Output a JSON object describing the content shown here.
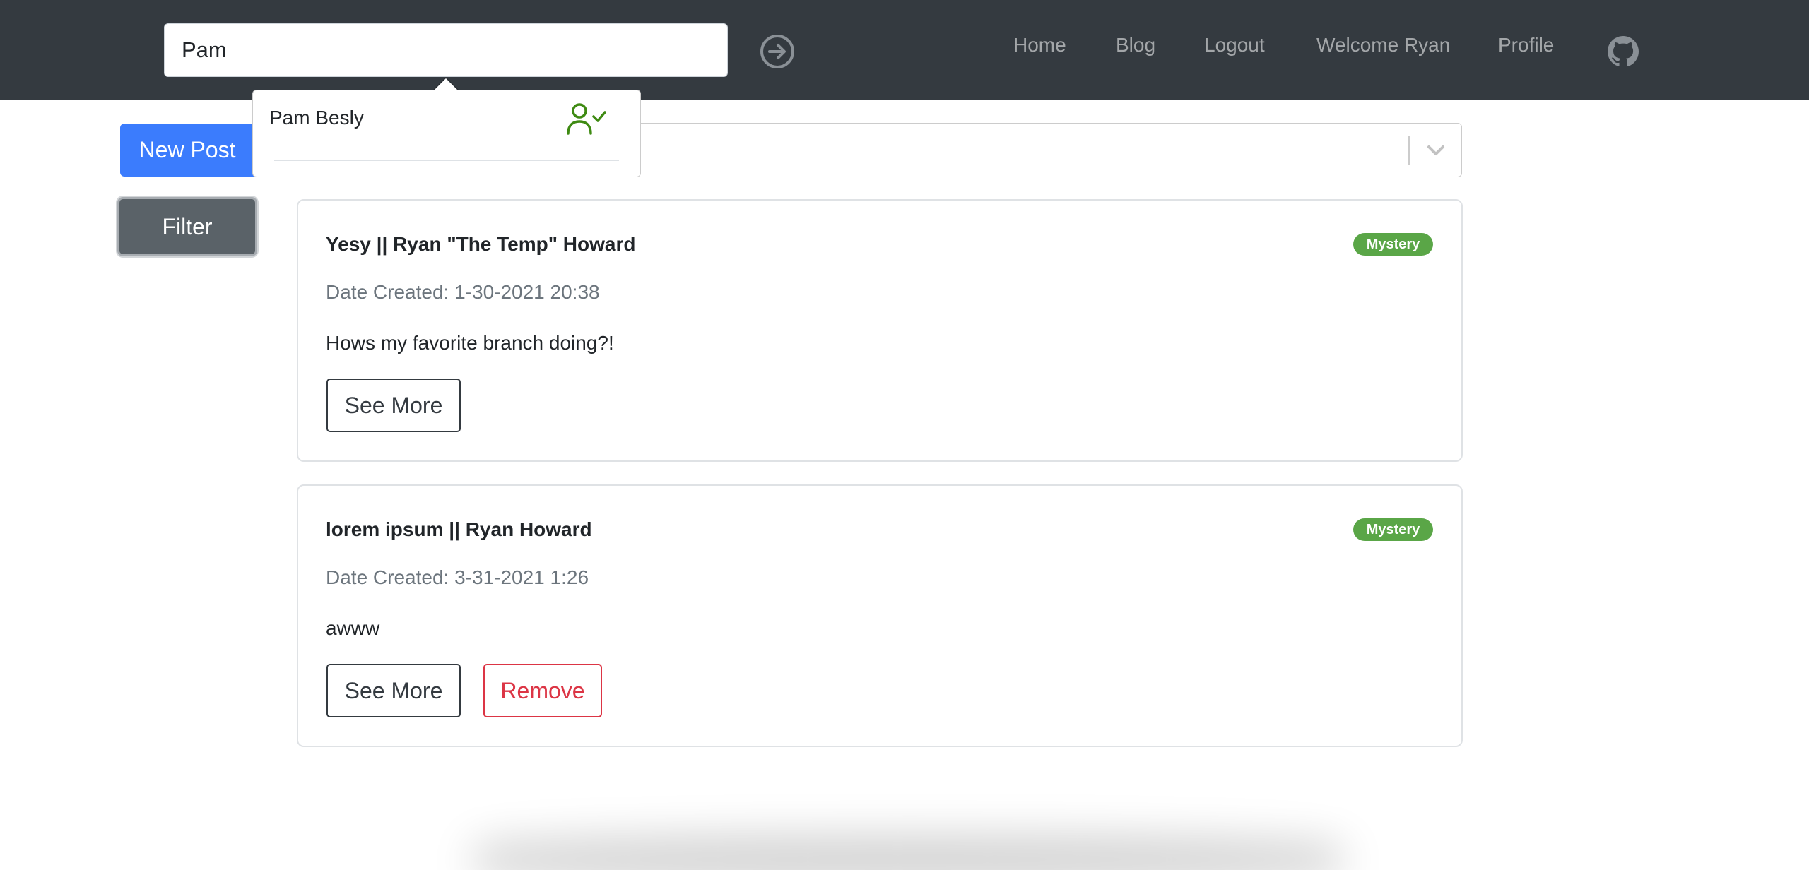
{
  "search": {
    "value": "Pam",
    "submit_icon": "arrow-right-circle-icon"
  },
  "nav": {
    "links": [
      {
        "label": "Home"
      },
      {
        "label": "Blog"
      },
      {
        "label": "Logout"
      },
      {
        "label": "Welcome Ryan"
      },
      {
        "label": "Profile"
      }
    ],
    "github_icon": "github-icon"
  },
  "actions": {
    "new_post_label": "New Post",
    "filter_label": "Filter"
  },
  "category_select": {
    "value": "",
    "chevron_icon": "chevron-down-icon"
  },
  "popover": {
    "user_name": "Pam Besly",
    "user_icon": "user-check-icon"
  },
  "posts": [
    {
      "title": "Yesy || Ryan \"The Temp\" Howard",
      "badge": "Mystery",
      "date": "Date Created: 1-30-2021 20:38",
      "body": "Hows my favorite branch doing?!",
      "see_more_label": "See More"
    },
    {
      "title": "lorem ipsum || Ryan Howard",
      "badge": "Mystery",
      "date": "Date Created: 3-31-2021 1:26",
      "body": "awww",
      "see_more_label": "See More",
      "remove_label": "Remove"
    }
  ],
  "colors": {
    "navbar": "#343a40",
    "primary": "#3b7cfd",
    "badge": "#5aa647",
    "danger": "#dc3545",
    "user_icon": "#3e8a12"
  }
}
